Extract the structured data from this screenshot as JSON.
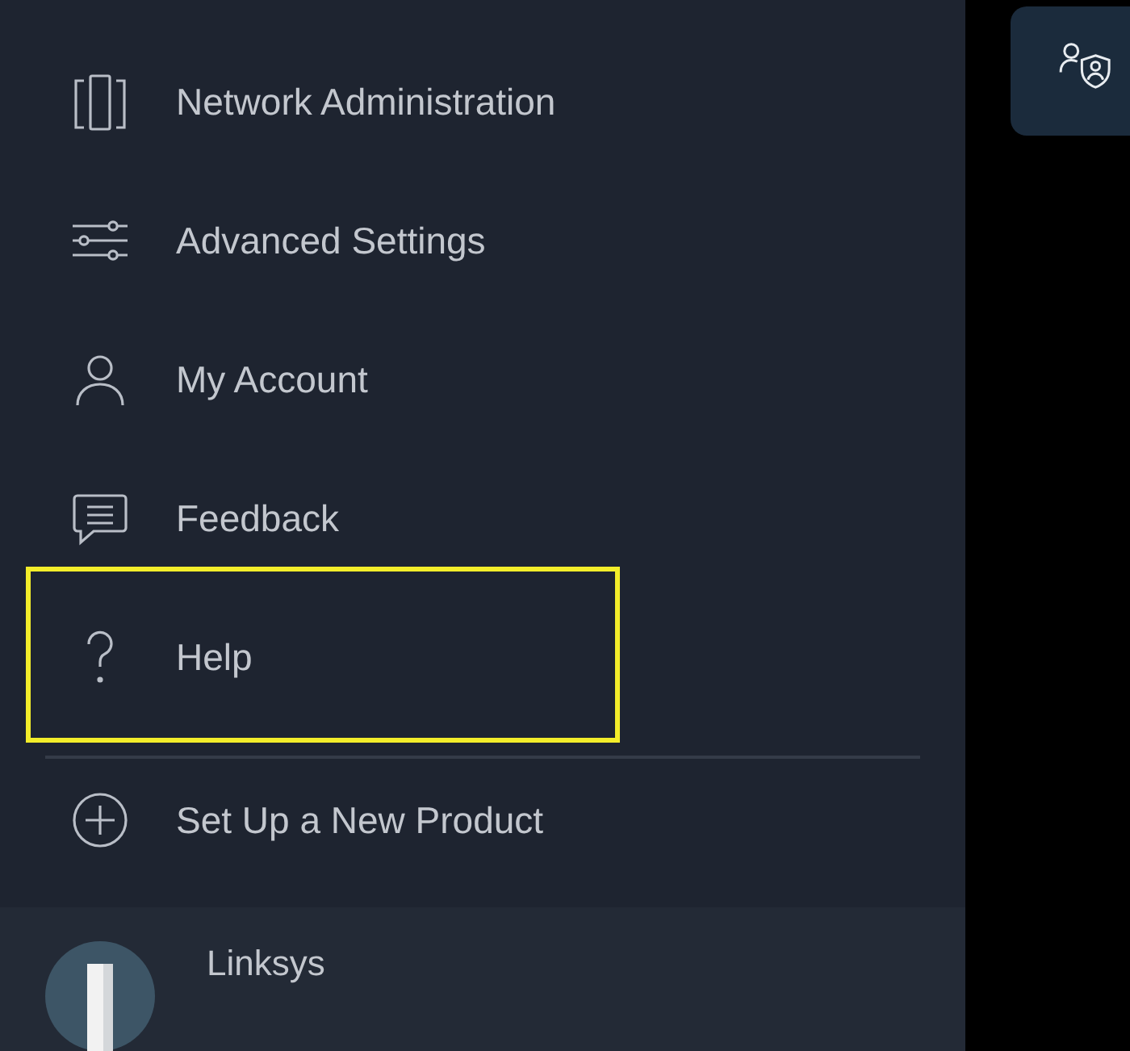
{
  "menu": [
    {
      "label": "Network Administration",
      "kind": "nodes",
      "highlighted": false
    },
    {
      "label": "Advanced Settings",
      "kind": "sliders",
      "highlighted": false
    },
    {
      "label": "My Account",
      "kind": "person",
      "highlighted": false
    },
    {
      "label": "Feedback",
      "kind": "chat",
      "highlighted": false
    },
    {
      "label": "Help",
      "kind": "question",
      "highlighted": true
    }
  ],
  "setup_item": {
    "label": "Set Up a New Product"
  },
  "footer": {
    "name": "Linksys"
  }
}
